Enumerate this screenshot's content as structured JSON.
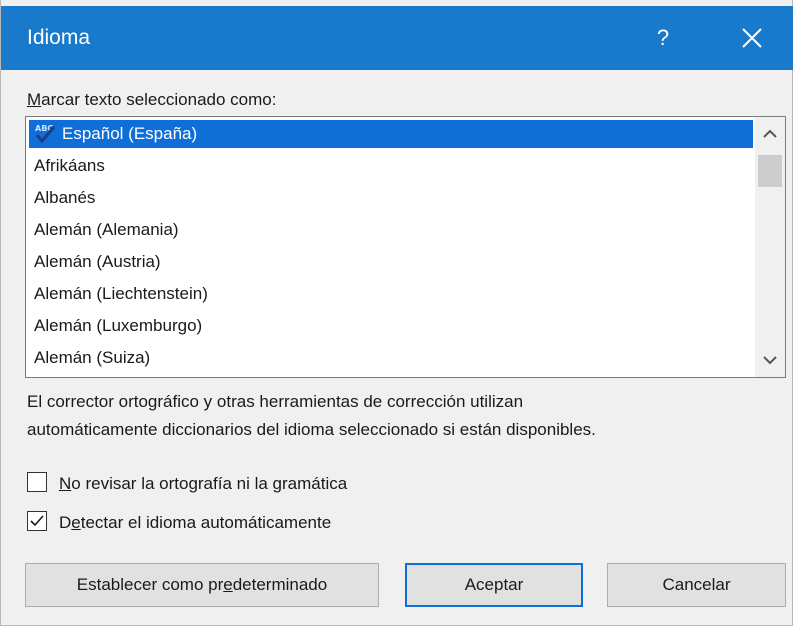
{
  "dialog": {
    "title": "Idioma",
    "help_label": "?",
    "list_label_accel": "M",
    "list_label_rest": "arcar texto seleccionado como:",
    "languages": [
      "Español (España)",
      "Afrikáans",
      "Albanés",
      "Alemán (Alemania)",
      "Alemán (Austria)",
      "Alemán (Liechtenstein)",
      "Alemán (Luxemburgo)",
      "Alemán (Suiza)"
    ],
    "selected_index": 0,
    "info_line1": "El corrector ortográfico y otras herramientas de corrección utilizan",
    "info_line2": "automáticamente diccionarios del idioma seleccionado si están disponibles.",
    "no_check": {
      "accel": "N",
      "rest": "o revisar la ortografía ni la gramática",
      "checked": false
    },
    "detect": {
      "pre": "D",
      "accel": "e",
      "rest": "tectar el idioma automáticamente",
      "checked": true
    },
    "buttons": {
      "default_pre": "Establecer como pr",
      "default_accel": "e",
      "default_rest": "determinado",
      "accept": "Aceptar",
      "cancel": "Cancelar"
    }
  },
  "colors": {
    "titlebar": "#1979ca",
    "selection": "#0f6fd6"
  }
}
